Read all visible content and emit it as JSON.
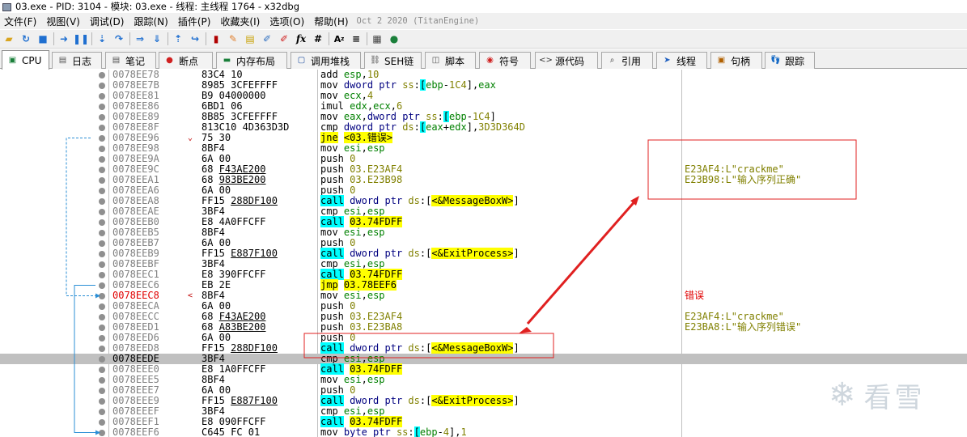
{
  "title": "03.exe - PID: 3104 - 模块: 03.exe - 线程: 主线程 1764 - x32dbg",
  "menu": [
    "文件(F)",
    "视图(V)",
    "调试(D)",
    "跟踪(N)",
    "插件(P)",
    "收藏夹(I)",
    "选项(O)",
    "帮助(H)"
  ],
  "build_date": "Oct 2 2020 (TitanEngine)",
  "tabs": [
    {
      "label": "CPU",
      "icon": "cpu-icon"
    },
    {
      "label": "日志",
      "icon": "log-icon"
    },
    {
      "label": "笔记",
      "icon": "notes-icon"
    },
    {
      "label": "断点",
      "icon": "breakpoint-icon"
    },
    {
      "label": "内存布局",
      "icon": "memory-map-icon"
    },
    {
      "label": "调用堆栈",
      "icon": "call-stack-icon"
    },
    {
      "label": "SEH链",
      "icon": "seh-icon"
    },
    {
      "label": "脚本",
      "icon": "script-icon"
    },
    {
      "label": "符号",
      "icon": "symbols-icon"
    },
    {
      "label": "源代码",
      "icon": "source-icon"
    },
    {
      "label": "引用",
      "icon": "references-icon"
    },
    {
      "label": "线程",
      "icon": "threads-icon"
    },
    {
      "label": "句柄",
      "icon": "handles-icon"
    },
    {
      "label": "跟踪",
      "icon": "trace-icon"
    }
  ],
  "rows": [
    {
      "addr": "0078EE78",
      "bytes": "83C4 10",
      "dis": "add esp,10",
      "cmt": ""
    },
    {
      "addr": "0078EE7B",
      "bytes": "8985 3CFEFFFF",
      "dis": "mov dword ptr ss:[ebp-1C4],eax",
      "cmt": ""
    },
    {
      "addr": "0078EE81",
      "bytes": "B9 04000000",
      "dis": "mov ecx,4",
      "cmt": ""
    },
    {
      "addr": "0078EE86",
      "bytes": "6BD1 06",
      "dis": "imul edx,ecx,6",
      "cmt": ""
    },
    {
      "addr": "0078EE89",
      "bytes": "8B85 3CFEFFFF",
      "dis": "mov eax,dword ptr ss:[ebp-1C4]",
      "cmt": ""
    },
    {
      "addr": "0078EE8F",
      "bytes": "813C10 4D363D3D",
      "dis": "cmp dword ptr ds:[eax+edx],3D3D364D",
      "cmt": ""
    },
    {
      "addr": "0078EE96",
      "bytes": "75 30",
      "dis": "jne <03.错误>",
      "cmt": ""
    },
    {
      "addr": "0078EE98",
      "bytes": "8BF4",
      "dis": "mov esi,esp",
      "cmt": ""
    },
    {
      "addr": "0078EE9A",
      "bytes": "6A 00",
      "dis": "push 0",
      "cmt": ""
    },
    {
      "addr": "0078EE9C",
      "bytes": "68 F43AE200",
      "dis": "push 03.E23AF4",
      "cmt": "E23AF4:L\"crackme\""
    },
    {
      "addr": "0078EEA1",
      "bytes": "68 983BE200",
      "dis": "push 03.E23B98",
      "cmt": "E23B98:L\"输入序列正确\""
    },
    {
      "addr": "0078EEA6",
      "bytes": "6A 00",
      "dis": "push 0",
      "cmt": ""
    },
    {
      "addr": "0078EEA8",
      "bytes": "FF15 288DF100",
      "dis": "call dword ptr ds:[<&MessageBoxW>]",
      "cmt": ""
    },
    {
      "addr": "0078EEAE",
      "bytes": "3BF4",
      "dis": "cmp esi,esp",
      "cmt": ""
    },
    {
      "addr": "0078EEB0",
      "bytes": "E8 4A0FFCFF",
      "dis": "call 03.74FDFF",
      "cmt": ""
    },
    {
      "addr": "0078EEB5",
      "bytes": "8BF4",
      "dis": "mov esi,esp",
      "cmt": ""
    },
    {
      "addr": "0078EEB7",
      "bytes": "6A 00",
      "dis": "push 0",
      "cmt": ""
    },
    {
      "addr": "0078EEB9",
      "bytes": "FF15 E887F100",
      "dis": "call dword ptr ds:[<&ExitProcess>]",
      "cmt": ""
    },
    {
      "addr": "0078EEBF",
      "bytes": "3BF4",
      "dis": "cmp esi,esp",
      "cmt": ""
    },
    {
      "addr": "0078EEC1",
      "bytes": "E8 390FFCFF",
      "dis": "call 03.74FDFF",
      "cmt": ""
    },
    {
      "addr": "0078EEC6",
      "bytes": "EB 2E",
      "dis": "jmp 03.78EEF6",
      "cmt": ""
    },
    {
      "addr": "0078EEC8",
      "bytes": "8BF4",
      "dis": "mov esi,esp",
      "cmt": "错误"
    },
    {
      "addr": "0078EECA",
      "bytes": "6A 00",
      "dis": "push 0",
      "cmt": ""
    },
    {
      "addr": "0078EECC",
      "bytes": "68 F43AE200",
      "dis": "push 03.E23AF4",
      "cmt": "E23AF4:L\"crackme\""
    },
    {
      "addr": "0078EED1",
      "bytes": "68 A83BE200",
      "dis": "push 03.E23BA8",
      "cmt": "E23BA8:L\"输入序列错误\""
    },
    {
      "addr": "0078EED6",
      "bytes": "6A 00",
      "dis": "push 0",
      "cmt": ""
    },
    {
      "addr": "0078EED8",
      "bytes": "FF15 288DF100",
      "dis": "call dword ptr ds:[<&MessageBoxW>]",
      "cmt": ""
    },
    {
      "addr": "0078EEDE",
      "bytes": "3BF4",
      "dis": "cmp esi,esp",
      "cmt": ""
    },
    {
      "addr": "0078EEE0",
      "bytes": "E8 1A0FFCFF",
      "dis": "call 03.74FDFF",
      "cmt": ""
    },
    {
      "addr": "0078EEE5",
      "bytes": "8BF4",
      "dis": "mov esi,esp",
      "cmt": ""
    },
    {
      "addr": "0078EEE7",
      "bytes": "6A 00",
      "dis": "push 0",
      "cmt": ""
    },
    {
      "addr": "0078EEE9",
      "bytes": "FF15 E887F100",
      "dis": "call dword ptr ds:[<&ExitProcess>]",
      "cmt": ""
    },
    {
      "addr": "0078EEEF",
      "bytes": "3BF4",
      "dis": "cmp esi,esp",
      "cmt": ""
    },
    {
      "addr": "0078EEF1",
      "bytes": "E8 090FFCFF",
      "dis": "call 03.74FDFF",
      "cmt": ""
    },
    {
      "addr": "0078EEF6",
      "bytes": "C645 FC 01",
      "dis": "mov byte ptr ss:[ebp-4],1",
      "cmt": ""
    }
  ],
  "selected_address": "0078EEDE",
  "label_address": "0078EEC8",
  "watermark": "看雪",
  "colors": {
    "annotation_red": "#e02020",
    "cyan_highlight": "#00ffff",
    "yellow_highlight": "#ffff00",
    "selected_row": "#c0c0c0"
  }
}
